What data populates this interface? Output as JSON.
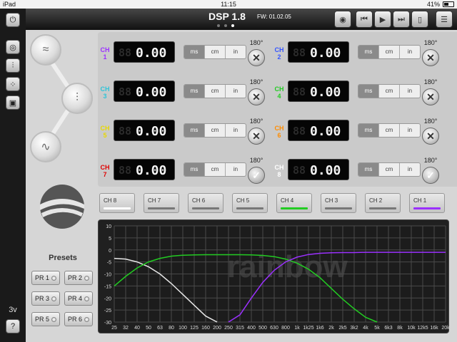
{
  "status": {
    "device": "iPad",
    "time": "11:15",
    "battery": "41%",
    "battery_fraction": 0.41
  },
  "header": {
    "title": "DSP 1.8",
    "firmware": "FW: 01.02.05",
    "pages": 3,
    "active_page": 2
  },
  "side": {
    "voltage": "3v",
    "help_label": "?"
  },
  "units": [
    "ms",
    "cm",
    "in"
  ],
  "channels": [
    {
      "label": "CH",
      "num": "1",
      "color": "#9b30ff",
      "value": "0.00",
      "ghost": "88",
      "phase": "180°",
      "toggle": "x"
    },
    {
      "label": "CH",
      "num": "2",
      "color": "#3455ff",
      "value": "0.00",
      "ghost": "88",
      "phase": "180°",
      "toggle": "x"
    },
    {
      "label": "CH",
      "num": "3",
      "color": "#2ec4d8",
      "value": "0.00",
      "ghost": "88",
      "phase": "180°",
      "toggle": "x"
    },
    {
      "label": "CH",
      "num": "4",
      "color": "#22cc22",
      "value": "0.00",
      "ghost": "88",
      "phase": "180°",
      "toggle": "x"
    },
    {
      "label": "CH",
      "num": "5",
      "color": "#e8d800",
      "value": "0.00",
      "ghost": "88",
      "phase": "180°",
      "toggle": "x"
    },
    {
      "label": "CH",
      "num": "6",
      "color": "#ff8c00",
      "value": "0.00",
      "ghost": "88",
      "phase": "180°",
      "toggle": "x"
    },
    {
      "label": "CH",
      "num": "7",
      "color": "#e00000",
      "value": "0.00",
      "ghost": "88",
      "phase": "180°",
      "toggle": "check"
    },
    {
      "label": "CH",
      "num": "8",
      "color": "#ffffff",
      "value": "0.00",
      "ghost": "88",
      "phase": "180°",
      "toggle": "check"
    }
  ],
  "channel_tabs": [
    {
      "label": "CH 8",
      "color": "#ffffff"
    },
    {
      "label": "CH 7",
      "color": "#777777"
    },
    {
      "label": "CH 6",
      "color": "#777777"
    },
    {
      "label": "CH 5",
      "color": "#777777"
    },
    {
      "label": "CH 4",
      "color": "#22cc22"
    },
    {
      "label": "CH 3",
      "color": "#777777"
    },
    {
      "label": "CH 2",
      "color": "#777777"
    },
    {
      "label": "CH 1",
      "color": "#9b30ff"
    }
  ],
  "presets": {
    "title": "Presets",
    "items": [
      "PR 1",
      "PR 2",
      "PR 3",
      "PR 4",
      "PR 5",
      "PR 6"
    ]
  },
  "graph_watermark": "rainbow",
  "chart_data": {
    "type": "line",
    "y_ticks": [
      "10",
      "5",
      "0",
      "-5",
      "-10",
      "-15",
      "-20",
      "-25",
      "-30"
    ],
    "ylim": [
      -30,
      10
    ],
    "x_ticks": [
      "25",
      "32",
      "40",
      "50",
      "63",
      "80",
      "100",
      "125",
      "160",
      "200",
      "250",
      "315",
      "400",
      "500",
      "630",
      "800",
      "1k",
      "1k25",
      "1k6",
      "2k",
      "2k5",
      "3k2",
      "4k",
      "5k",
      "6k3",
      "8k",
      "10k",
      "12k5",
      "16k",
      "20k"
    ],
    "series": [
      {
        "color": "#e8e8e8",
        "points": [
          [
            0,
            -3.5
          ],
          [
            1,
            -3.8
          ],
          [
            2,
            -5
          ],
          [
            3,
            -7
          ],
          [
            4,
            -10
          ],
          [
            5,
            -14
          ],
          [
            6,
            -18.5
          ],
          [
            7,
            -23
          ],
          [
            8,
            -27.5
          ],
          [
            9,
            -31
          ]
        ]
      },
      {
        "color": "#22cc22",
        "points": [
          [
            0,
            -15
          ],
          [
            1,
            -11
          ],
          [
            2,
            -7.5
          ],
          [
            3,
            -5
          ],
          [
            4,
            -3.5
          ],
          [
            5,
            -2.6
          ],
          [
            6,
            -2.2
          ],
          [
            7,
            -2.1
          ],
          [
            8,
            -2
          ],
          [
            9,
            -2
          ],
          [
            10,
            -2
          ],
          [
            11,
            -2
          ],
          [
            12,
            -2.1
          ],
          [
            13,
            -2.3
          ],
          [
            14,
            -2.8
          ],
          [
            15,
            -3.8
          ],
          [
            16,
            -5.5
          ],
          [
            17,
            -8
          ],
          [
            18,
            -11.5
          ],
          [
            19,
            -16
          ],
          [
            20,
            -20.5
          ],
          [
            21,
            -24.5
          ],
          [
            22,
            -28
          ],
          [
            23,
            -31
          ]
        ]
      },
      {
        "color": "#9b30ff",
        "points": [
          [
            10,
            -31
          ],
          [
            11,
            -27
          ],
          [
            12,
            -20
          ],
          [
            13,
            -13.5
          ],
          [
            14,
            -8.5
          ],
          [
            15,
            -5
          ],
          [
            16,
            -3
          ],
          [
            17,
            -1.9
          ],
          [
            18,
            -1.4
          ],
          [
            19,
            -1.2
          ],
          [
            20,
            -1.1
          ],
          [
            21,
            -1.1
          ],
          [
            22,
            -1
          ],
          [
            23,
            -1
          ],
          [
            24,
            -1
          ],
          [
            25,
            -1
          ],
          [
            26,
            -1
          ],
          [
            27,
            -1
          ],
          [
            28,
            -1
          ],
          [
            29,
            -1
          ]
        ]
      }
    ]
  }
}
